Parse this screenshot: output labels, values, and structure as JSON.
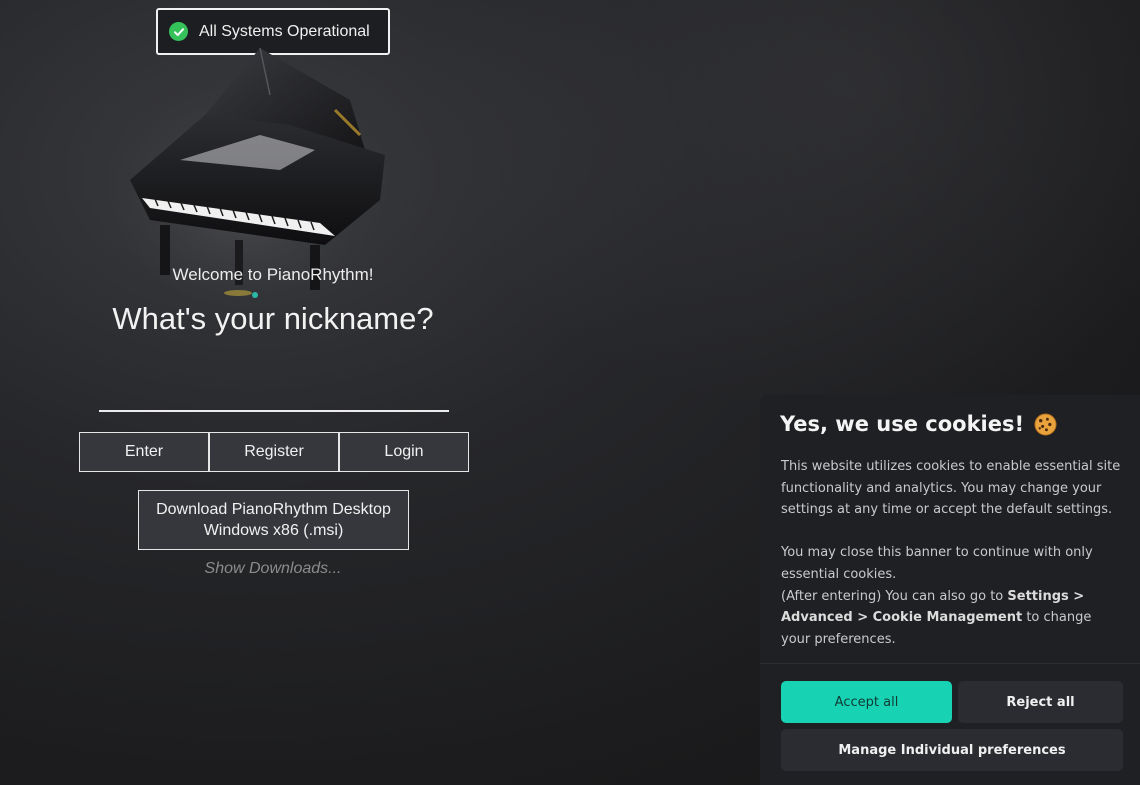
{
  "status": {
    "text": "All Systems Operational",
    "color": "#36c25b"
  },
  "welcome": {
    "greeting": "Welcome to PianoRhythm!",
    "question": "What's your nickname?",
    "nickname_value": "",
    "nickname_placeholder": ""
  },
  "buttons": {
    "enter": "Enter",
    "register": "Register",
    "login": "Login"
  },
  "download": {
    "line1": "Download PianoRhythm Desktop",
    "line2": "Windows x86 (.msi)",
    "show_downloads": "Show Downloads..."
  },
  "cookie_banner": {
    "title": "Yes, we use cookies!",
    "icon": "cookie-icon",
    "para1": "This website utilizes cookies to enable essential site functionality and analytics. You may change your settings at any time or accept the default settings.",
    "para2": "You may close this banner to continue with only essential cookies.",
    "para3_prefix": "(After entering) You can also go to ",
    "para3_path": "Settings > Advanced > Cookie Management",
    "para3_suffix": " to change your preferences.",
    "accept_label": "Accept all",
    "reject_label": "Reject all",
    "manage_label": "Manage Individual preferences",
    "accent_color": "#17d3b3"
  }
}
